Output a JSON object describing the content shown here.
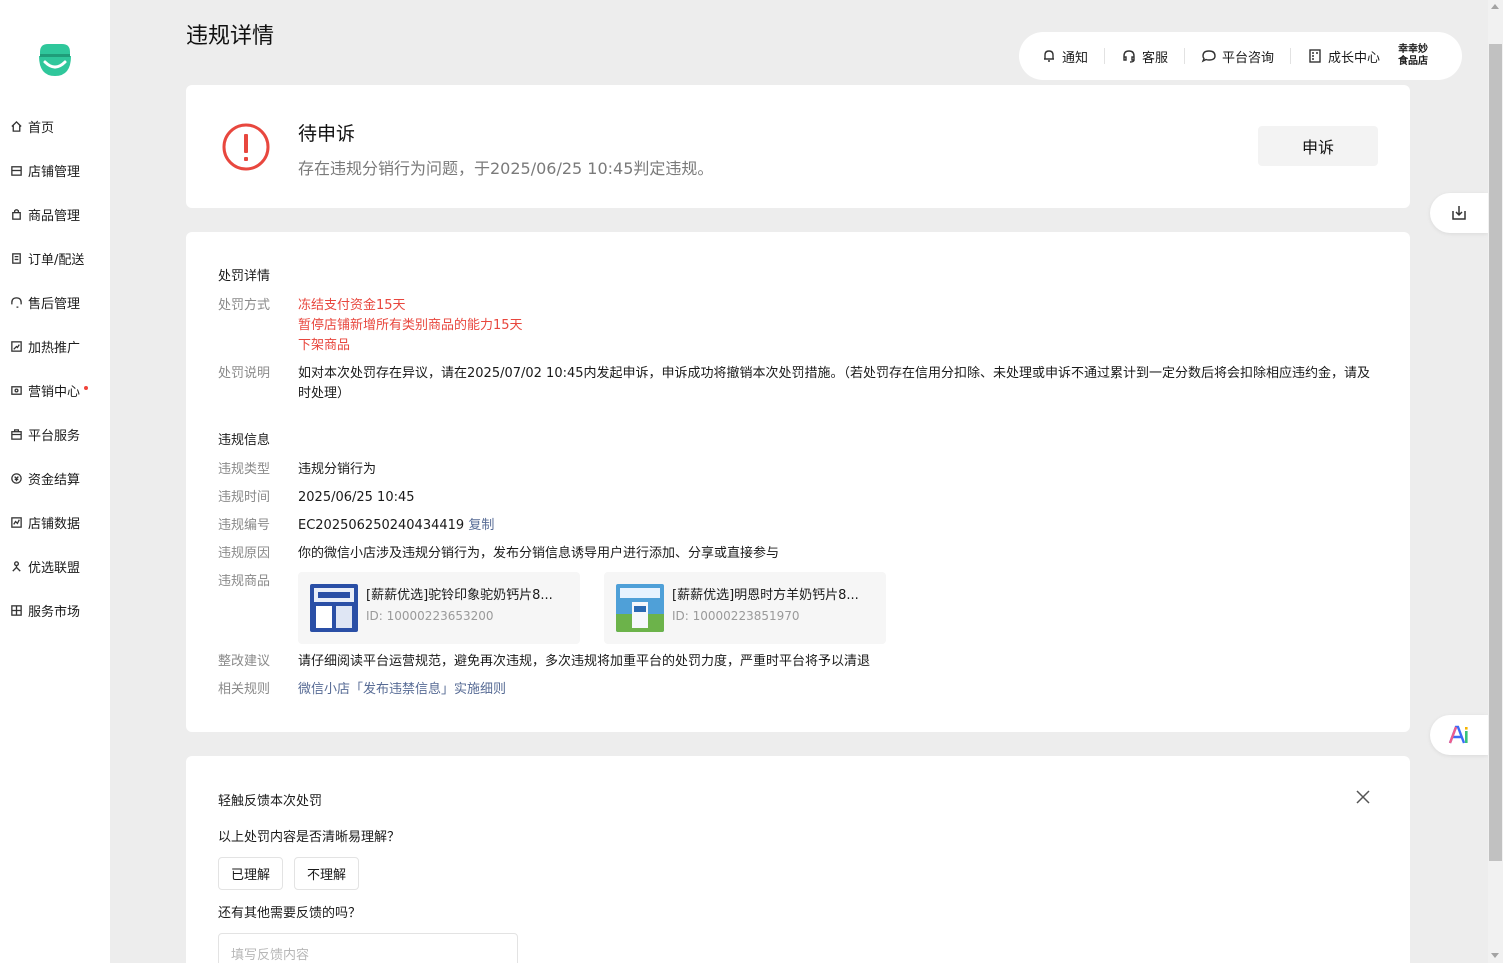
{
  "page_title": "违规详情",
  "sidebar": {
    "items": [
      {
        "label": "首页",
        "icon": "home-icon"
      },
      {
        "label": "店铺管理",
        "icon": "store-icon"
      },
      {
        "label": "商品管理",
        "icon": "bag-icon"
      },
      {
        "label": "订单/配送",
        "icon": "order-icon"
      },
      {
        "label": "售后管理",
        "icon": "headset-icon"
      },
      {
        "label": "加热推广",
        "icon": "promote-icon"
      },
      {
        "label": "营销中心",
        "icon": "marketing-icon"
      },
      {
        "label": "平台服务",
        "icon": "service-icon"
      },
      {
        "label": "资金结算",
        "icon": "money-icon"
      },
      {
        "label": "店铺数据",
        "icon": "chart-icon"
      },
      {
        "label": "优选联盟",
        "icon": "alliance-icon"
      },
      {
        "label": "服务市场",
        "icon": "market-icon"
      }
    ]
  },
  "topbar": {
    "notify": "通知",
    "support": "客服",
    "consult": "平台咨询",
    "growth": "成长中心",
    "store_line1": "幸幸妙",
    "store_line2": "食品店"
  },
  "status": {
    "title": "待申诉",
    "desc": "存在违规分销行为问题，于2025/06/25 10:45判定违规。",
    "appeal_label": "申诉"
  },
  "penalty": {
    "section_title": "处罚详情",
    "method_label": "处罚方式",
    "methods": [
      "冻结支付资金15天",
      "暂停店铺新增所有类别商品的能力15天",
      "下架商品"
    ],
    "desc_label": "处罚说明",
    "desc": "如对本次处罚存在异议，请在2025/07/02 10:45内发起申诉，申诉成功将撤销本次处罚措施。（若处罚存在信用分扣除、未处理或申诉不通过累计到一定分数后将会扣除相应违约金，请及时处理）"
  },
  "violation": {
    "section_title": "违规信息",
    "type_label": "违规类型",
    "type": "违规分销行为",
    "time_label": "违规时间",
    "time": "2025/06/25 10:45",
    "id_label": "违规编号",
    "id": "EC202506250240434419",
    "copy_label": "复制",
    "reason_label": "违规原因",
    "reason": "你的微信小店涉及违规分销行为，发布分销信息诱导用户进行添加、分享或直接参与",
    "products_label": "违规商品",
    "products": [
      {
        "name": "[薪薪优选]驼铃印象驼奶钙片8...",
        "id": "ID: 10000223653200"
      },
      {
        "name": "[薪薪优选]明恩时方羊奶钙片8...",
        "id": "ID: 10000223851970"
      }
    ],
    "advice_label": "整改建议",
    "advice": "请仔细阅读平台运营规范，避免再次违规，多次违规将加重平台的处罚力度，严重时平台将予以清退",
    "rule_label": "相关规则",
    "rule": "微信小店「发布违禁信息」实施细则"
  },
  "feedback": {
    "title": "轻触反馈本次处罚",
    "question1": "以上处罚内容是否清晰易理解？",
    "opt_yes": "已理解",
    "opt_no": "不理解",
    "question2": "还有其他需要反馈的吗？",
    "placeholder": "填写反馈内容"
  },
  "colors": {
    "accent_green": "#33c49a",
    "warning_red": "#e8473e",
    "link_blue": "#576b95"
  }
}
